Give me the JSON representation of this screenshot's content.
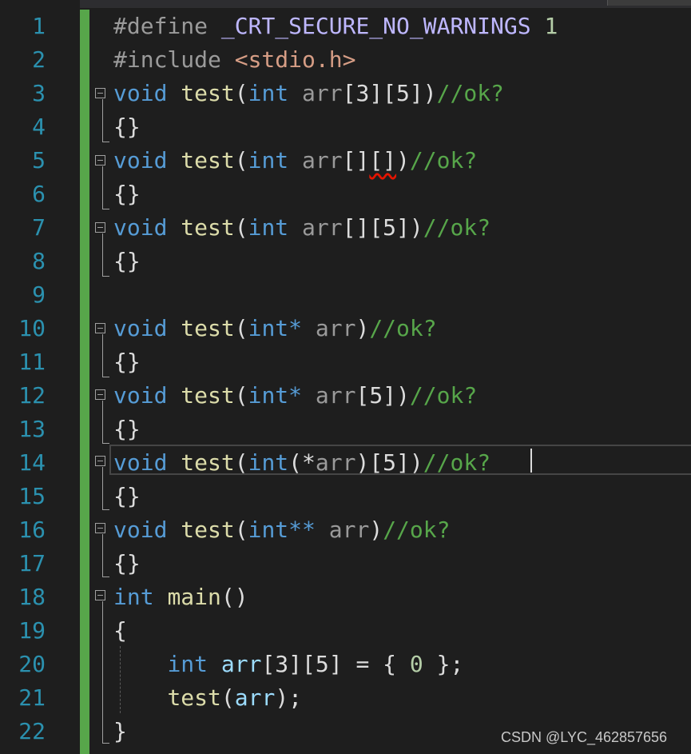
{
  "editor": {
    "line_numbers": [
      "1",
      "2",
      "3",
      "4",
      "5",
      "6",
      "7",
      "8",
      "9",
      "10",
      "11",
      "12",
      "13",
      "14",
      "15",
      "16",
      "17",
      "18",
      "19",
      "20",
      "21",
      "22"
    ],
    "lines": {
      "l1": {
        "directive": "#define",
        "macro": "_CRT_SECURE_NO_WARNINGS",
        "value": "1"
      },
      "l2": {
        "directive": "#include",
        "header": "<stdio.h>"
      },
      "l3": {
        "ret": "void",
        "fname": "test",
        "type": "int",
        "param": "arr",
        "dims": "[3][5]",
        "comment": "//ok?"
      },
      "l4": {
        "body": "{}"
      },
      "l5": {
        "ret": "void",
        "fname": "test",
        "type": "int",
        "param": "arr",
        "dims_a": "[]",
        "dims_b": "[]",
        "comment": "//ok?"
      },
      "l6": {
        "body": "{}"
      },
      "l7": {
        "ret": "void",
        "fname": "test",
        "type": "int",
        "param": "arr",
        "dims": "[][5]",
        "comment": "//ok?"
      },
      "l8": {
        "body": "{}"
      },
      "l10": {
        "ret": "void",
        "fname": "test",
        "type": "int*",
        "param": "arr",
        "comment": "//ok?"
      },
      "l11": {
        "body": "{}"
      },
      "l12": {
        "ret": "void",
        "fname": "test",
        "type": "int*",
        "param": "arr",
        "dims": "[5]",
        "comment": "//ok?"
      },
      "l13": {
        "body": "{}"
      },
      "l14": {
        "ret": "void",
        "fname": "test",
        "type": "int",
        "ptr_open": "(*",
        "param": "arr",
        "ptr_close": ")",
        "dims": "[5]",
        "comment": "//ok?"
      },
      "l15": {
        "body": "{}"
      },
      "l16": {
        "ret": "void",
        "fname": "test",
        "type": "int**",
        "param": "arr",
        "comment": "//ok?"
      },
      "l17": {
        "body": "{}"
      },
      "l18": {
        "ret": "int",
        "fname": "main",
        "params": "()"
      },
      "l19": {
        "brace": "{"
      },
      "l20": {
        "type": "int",
        "var": "arr",
        "dims": "[3][5]",
        "init_open": " = { ",
        "zero": "0",
        "init_close": " };"
      },
      "l21": {
        "call": "test",
        "arg": "arr",
        "end": ");"
      },
      "l22": {
        "brace": "}"
      }
    }
  },
  "watermark": "CSDN @LYC_462857656",
  "colors": {
    "background": "#1e1e1e",
    "line_number": "#2b91af",
    "keyword": "#569cd6",
    "function": "#dcdcaa",
    "comment": "#57a64a",
    "change_bar": "#57a64a"
  }
}
